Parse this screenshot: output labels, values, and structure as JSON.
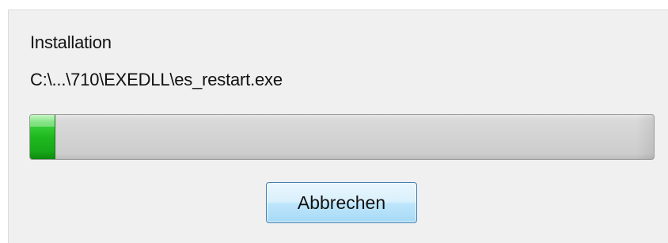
{
  "dialog": {
    "title_text": "Installation",
    "current_file": "C:\\...\\710\\EXEDLL\\es_restart.exe",
    "progress_fraction": 0.04,
    "progress_color": "#1fb91f",
    "cancel_label": "Abbrechen"
  }
}
